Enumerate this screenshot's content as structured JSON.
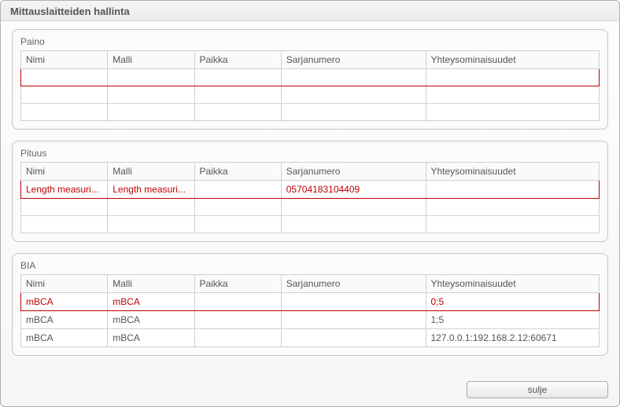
{
  "window": {
    "title": "Mittauslaitteiden hallinta"
  },
  "columns": {
    "nimi": "Nimi",
    "malli": "Malli",
    "paikka": "Paikka",
    "sarja": "Sarjanumero",
    "yht": "Yhteysominaisuudet"
  },
  "groups": {
    "paino": {
      "label": "Paino",
      "rows": [
        {
          "nimi": "",
          "malli": "",
          "paikka": "",
          "sarja": "",
          "yht": "",
          "selected": true
        },
        {
          "nimi": "",
          "malli": "",
          "paikka": "",
          "sarja": "",
          "yht": ""
        },
        {
          "nimi": "",
          "malli": "",
          "paikka": "",
          "sarja": "",
          "yht": ""
        }
      ]
    },
    "pituus": {
      "label": "Pituus",
      "rows": [
        {
          "nimi": "Length measuri...",
          "malli": "Length measuri...",
          "paikka": "",
          "sarja": "05704183104409",
          "yht": "",
          "selected": true
        },
        {
          "nimi": "",
          "malli": "",
          "paikka": "",
          "sarja": "",
          "yht": ""
        },
        {
          "nimi": "",
          "malli": "",
          "paikka": "",
          "sarja": "",
          "yht": ""
        }
      ]
    },
    "bia": {
      "label": "BIA",
      "rows": [
        {
          "nimi": "mBCA",
          "malli": "mBCA",
          "paikka": "",
          "sarja": "",
          "yht": "0;5",
          "selected": true
        },
        {
          "nimi": "mBCA",
          "malli": "mBCA",
          "paikka": "",
          "sarja": "",
          "yht": "1;5"
        },
        {
          "nimi": "mBCA",
          "malli": "mBCA",
          "paikka": "",
          "sarja": "",
          "yht": "127.0.0.1:192.168.2.12:60671"
        }
      ]
    }
  },
  "footer": {
    "close_label": "sulje"
  }
}
